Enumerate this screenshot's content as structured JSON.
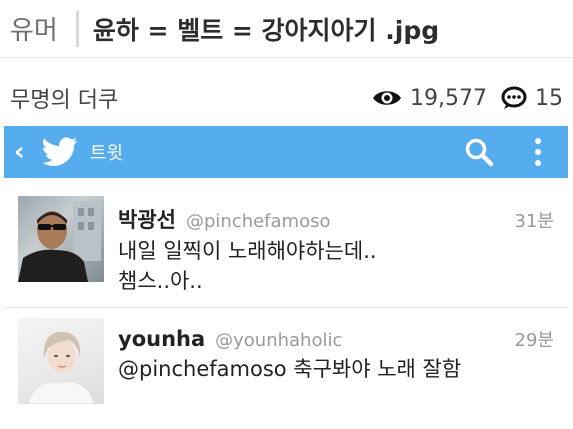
{
  "post": {
    "category": "유머",
    "title": "윤하 = 벨트 = 강아지아기 .jpg",
    "author": "무명의 더쿠",
    "views": "19,577",
    "comments": "15"
  },
  "app_bar": {
    "title": "트윗",
    "background_color": "#55acee"
  },
  "tweets": [
    {
      "name": "박광선",
      "handle": "@pinchefamoso",
      "time": "31분",
      "text": "내일 일찍이 노래해야하는데..\n챔스..아.."
    },
    {
      "name": "younha",
      "handle": "@younhaholic",
      "time": "29분",
      "text": "@pinchefamoso 축구봐야 노래 잘함"
    }
  ]
}
